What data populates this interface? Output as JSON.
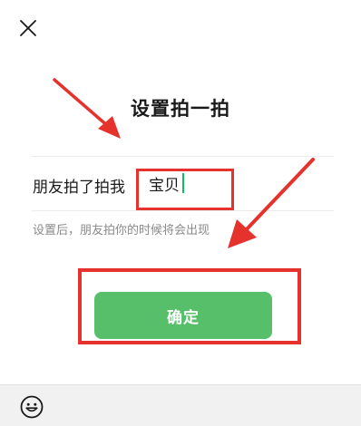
{
  "header": {
    "close_icon": "close-icon"
  },
  "dialog": {
    "title": "设置拍一拍",
    "prefix_label": "朋友拍了拍我",
    "input_value": "宝贝",
    "hint": "设置后，朋友拍你的时候将会出现",
    "confirm_label": "确定"
  },
  "bottom_bar": {
    "emoji_icon": "emoji-smile-icon"
  },
  "colors": {
    "accent_green": "#57be6a",
    "caret_green": "#07c160",
    "annotation_red": "#e5322d",
    "title_text": "#1a1a1a",
    "hint_text": "#8a8a8a",
    "bottom_bar_bg": "#f1f1f1"
  }
}
